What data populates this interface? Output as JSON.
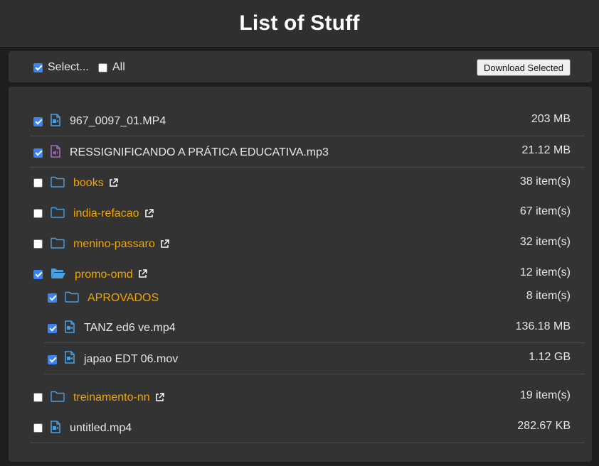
{
  "header": {
    "title": "List of Stuff"
  },
  "toolbar": {
    "select_label": "Select...",
    "select_checked": true,
    "all_label": "All",
    "all_checked": false,
    "download_button": "Download Selected"
  },
  "colors": {
    "accent": "#3b82f6",
    "folder_link": "#f0a500",
    "file_icon": "#4a9fe0",
    "audio_icon": "#a66bbe"
  },
  "items": [
    {
      "name": "967_0097_01.MP4",
      "size": "203 MB",
      "checked": true,
      "type": "video-file",
      "icon": "video-file-icon"
    },
    {
      "name": "RESSIGNIFICANDO A PRÁTICA EDUCATIVA.mp3",
      "size": "21.12 MB",
      "checked": true,
      "type": "audio-file",
      "icon": "audio-file-icon"
    },
    {
      "name": "books",
      "size": "38 item(s)",
      "checked": false,
      "type": "folder",
      "icon": "folder-icon"
    },
    {
      "name": "india-refacao",
      "size": "67 item(s)",
      "checked": false,
      "type": "folder",
      "icon": "folder-icon"
    },
    {
      "name": "menino-passaro",
      "size": "32 item(s)",
      "checked": false,
      "type": "folder",
      "icon": "folder-icon"
    },
    {
      "name": "promo-omd",
      "size": "12 item(s)",
      "checked": true,
      "type": "folder-open",
      "icon": "folder-open-icon",
      "children": [
        {
          "name": "APROVADOS",
          "size": "8 item(s)",
          "checked": true,
          "type": "folder",
          "icon": "folder-icon"
        },
        {
          "name": "TANZ ed6 ve.mp4",
          "size": "136.18 MB",
          "checked": true,
          "type": "video-file",
          "icon": "video-file-icon"
        },
        {
          "name": "japao EDT 06.mov",
          "size": "1.12 GB",
          "checked": true,
          "type": "video-file",
          "icon": "video-file-icon"
        }
      ]
    },
    {
      "name": "treinamento-nn",
      "size": "19 item(s)",
      "checked": false,
      "type": "folder",
      "icon": "folder-icon"
    },
    {
      "name": "untitled.mp4",
      "size": "282.67 KB",
      "checked": false,
      "type": "video-file",
      "icon": "video-file-icon"
    }
  ]
}
